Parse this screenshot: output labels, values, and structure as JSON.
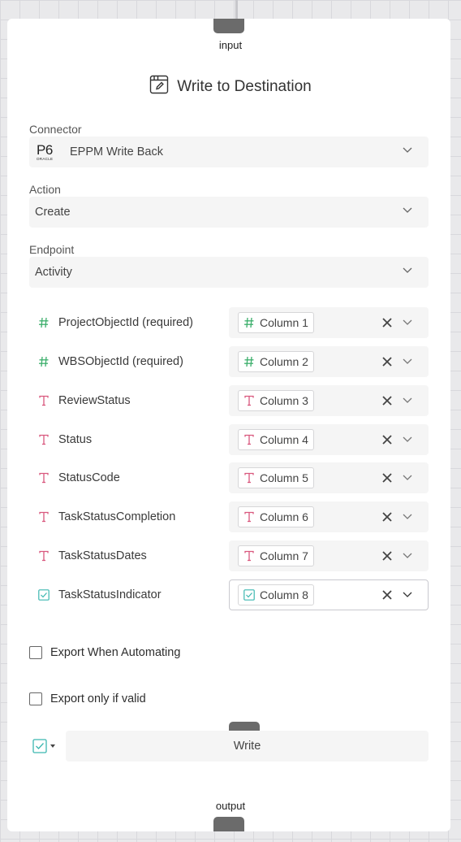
{
  "node": {
    "input_label": "input",
    "output_label": "output",
    "title": "Write to Destination",
    "title_icon": "edit-window-icon"
  },
  "connector": {
    "label": "Connector",
    "logo_text": "P6",
    "logo_subtext": "ORACLE",
    "value": "EPPM Write Back"
  },
  "action": {
    "label": "Action",
    "value": "Create"
  },
  "endpoint": {
    "label": "Endpoint",
    "value": "Activity"
  },
  "mappings": [
    {
      "field": "ProjectObjectId (required)",
      "type": "number",
      "column": "Column 1"
    },
    {
      "field": "WBSObjectId (required)",
      "type": "number",
      "column": "Column 2"
    },
    {
      "field": "ReviewStatus",
      "type": "text",
      "column": "Column 3"
    },
    {
      "field": "Status",
      "type": "text",
      "column": "Column 4"
    },
    {
      "field": "StatusCode",
      "type": "text",
      "column": "Column 5"
    },
    {
      "field": "TaskStatusCompletion",
      "type": "text",
      "column": "Column 6"
    },
    {
      "field": "TaskStatusDates",
      "type": "text",
      "column": "Column 7"
    },
    {
      "field": "TaskStatusIndicator",
      "type": "boolean",
      "column": "Column 8"
    }
  ],
  "options": {
    "export_when_automating": {
      "label": "Export When Automating",
      "checked": false
    },
    "export_only_if_valid": {
      "label": "Export only if valid",
      "checked": false
    }
  },
  "write": {
    "label": "Write",
    "mode_icon": "checkbox-icon"
  },
  "colors": {
    "number_icon": "#3aae6a",
    "text_icon": "#d9587e",
    "boolean_icon": "#3bb7b0",
    "port": "#6b6b6b"
  }
}
